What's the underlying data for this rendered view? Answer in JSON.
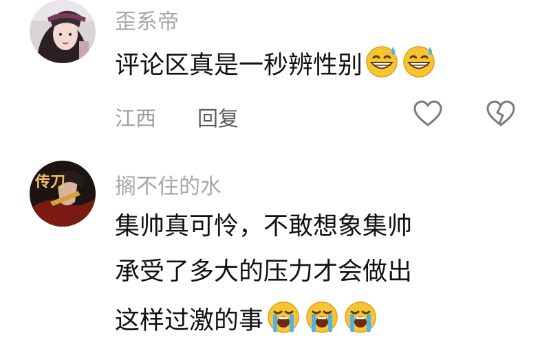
{
  "comments": [
    {
      "username": "歪系帝",
      "text": "评论区真是一秒辨性别",
      "emojis": [
        "grinning-sweat-emoji",
        "grinning-sweat-emoji"
      ],
      "location": "江西",
      "reply_label": "回复",
      "actions": [
        "heart-icon",
        "broken-heart-icon"
      ]
    },
    {
      "username": "搁不住的水",
      "lines": [
        "集帅真可怜，不敢想象集帅",
        "承受了多大的压力才会做出",
        "这样过激的事"
      ],
      "emojis": [
        "loudly-crying-emoji",
        "loudly-crying-emoji",
        "loudly-crying-emoji"
      ],
      "avatar_text": "传刀"
    }
  ]
}
